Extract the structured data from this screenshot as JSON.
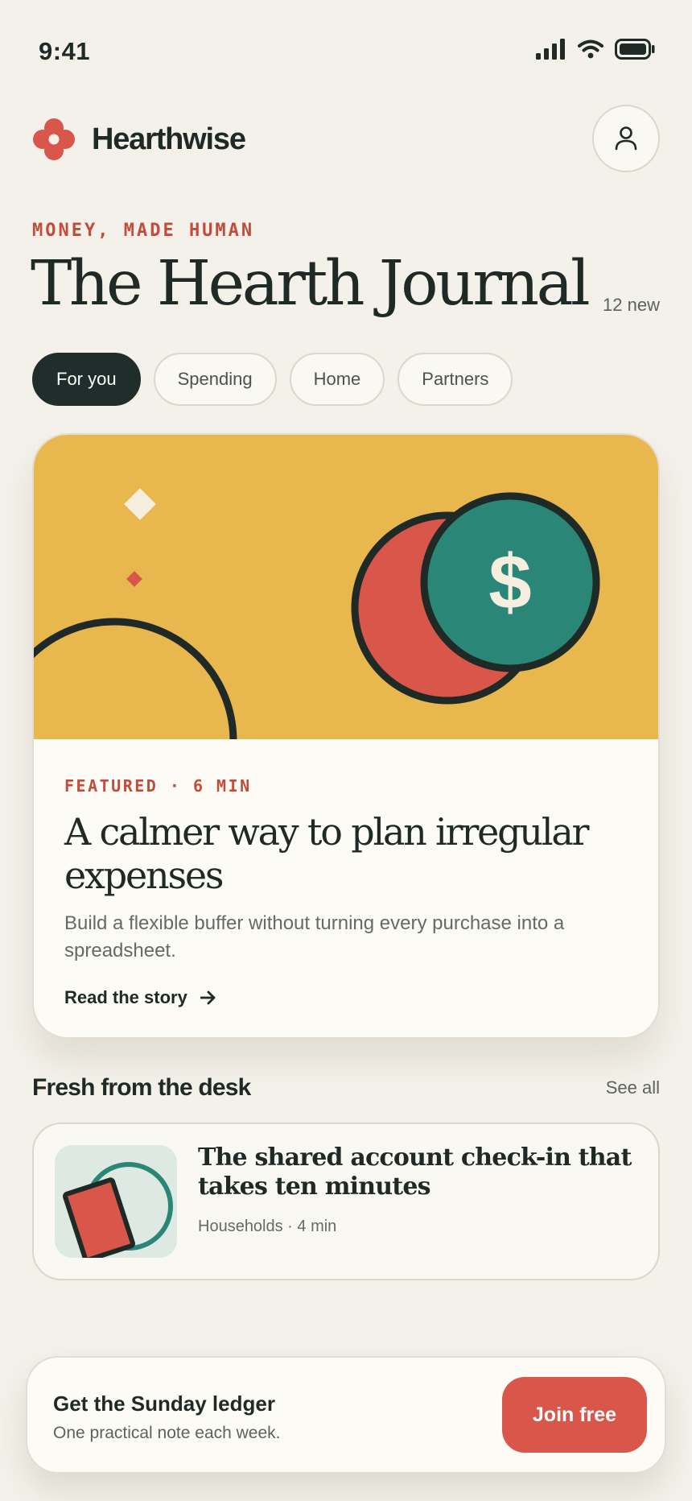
{
  "status_bar": {
    "time": "9:41",
    "icons": [
      "signal-icon",
      "wifi-icon",
      "battery-icon"
    ]
  },
  "header": {
    "brand_name": "Hearthwise",
    "logo_icon": "flower-logo-icon",
    "profile_icon": "user-icon"
  },
  "hero": {
    "eyebrow": "MONEY, MADE HUMAN",
    "title": "The Hearth Journal",
    "new_count": "12 new"
  },
  "tabs": [
    {
      "label": "For you",
      "active": true
    },
    {
      "label": "Spending",
      "active": false
    },
    {
      "label": "Home",
      "active": false
    },
    {
      "label": "Partners",
      "active": false
    }
  ],
  "featured": {
    "meta": "FEATURED · 6 MIN",
    "title": "A calmer way to plan irregular expenses",
    "description": "Build a flexible buffer without turning every purchase into a spreadsheet.",
    "cta": "Read the story",
    "art_symbol": "$"
  },
  "section": {
    "title": "Fresh from the desk",
    "see_all": "See all"
  },
  "articles": [
    {
      "title": "The shared account check-in that takes ten minutes",
      "meta": "Households · 4 min"
    }
  ],
  "newsletter": {
    "title": "Get the Sunday ledger",
    "subtitle": "One practical note each week.",
    "button": "Join free"
  },
  "colors": {
    "background": "#f4f1ea",
    "ink": "#1f2a27",
    "accent_red": "#d9564a",
    "mustard": "#e8b84e",
    "teal": "#2a8778"
  }
}
